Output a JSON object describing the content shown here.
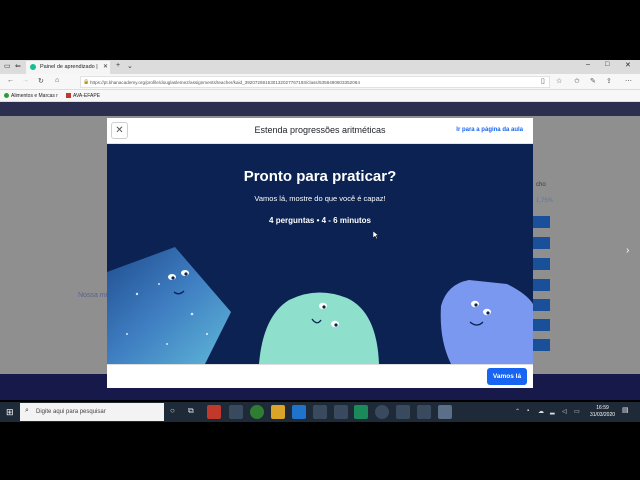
{
  "browser": {
    "tab_title": "Painel de aprendizado |",
    "url": "https://pt.khanacademy.org/profile/douglasleme2/assignments/teacher/kaid_392072691530132027767193/class/5358490603352064",
    "favorites": [
      "Alimentos e Marcas r",
      "AVA-EFAPE"
    ]
  },
  "modal": {
    "title": "Estenda progressões aritméticas",
    "link": "Ir para a página da aula",
    "hero_title": "Pronto para praticar?",
    "hero_subtitle": "Vamos lá, mostre do que você é capaz!",
    "hero_meta": "4 perguntas • 4 - 6 minutos",
    "start_button": "Vamos lá"
  },
  "background_page": {
    "footer_text": "Nossa missão é oferecer uma educação gratuita e",
    "side_text": "cho",
    "percent": "1,75%",
    "button_label": "iciar"
  },
  "taskbar": {
    "search_placeholder": "Digite aqui para pesquisar",
    "time": "16:59",
    "date": "31/03/2020"
  },
  "colors": {
    "accent": "#1865f2",
    "hero_bg": "#0b2253",
    "taskbar_bg": "#1f2a38"
  }
}
